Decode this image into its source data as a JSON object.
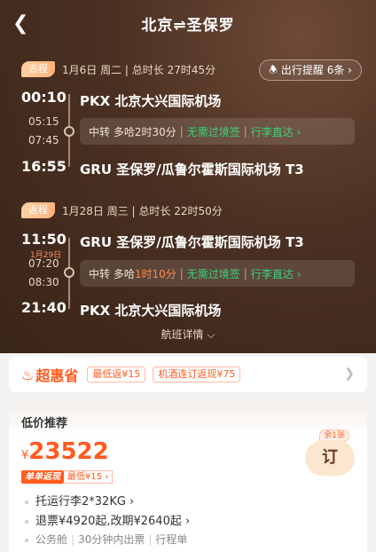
{
  "header": {
    "title": "北京⇌圣保罗",
    "back_icon": "chevron-left-icon"
  },
  "reminder": {
    "label": "出行提醒 6条 ›",
    "icon": "bell-icon"
  },
  "outbound": {
    "tag": "去程",
    "summary": "1月6日 周二 | 总时长 27时45分",
    "dep_time": "00:10",
    "dep_airport": "PKX 北京大兴国际机场",
    "transfer_arrive": "05:15",
    "transfer_depart": "07:45",
    "transfer_label": "中转 多哈",
    "transfer_duration": "2时30分",
    "visa": "无需过境签",
    "baggage": "行李直达 ›",
    "arr_time": "16:55",
    "arr_airport": "GRU 圣保罗/瓜鲁尔霍斯国际机场 T3"
  },
  "return": {
    "tag": "返程",
    "summary": "1月28日 周三 | 总时长 22时50分",
    "dep_time": "11:50",
    "dep_airport": "GRU 圣保罗/瓜鲁尔霍斯国际机场 T3",
    "next_day": "1月29日",
    "transfer_arrive": "07:20",
    "transfer_depart": "08:30",
    "transfer_label": "中转 多哈",
    "transfer_duration": "1时10分",
    "visa": "无需过境签",
    "baggage": "行李直达 ›",
    "arr_time": "21:40",
    "arr_airport": "PKX 北京大兴国际机场"
  },
  "flight_detail": "航班详情 ⌵",
  "promo": {
    "brand": "超惠省",
    "chips": [
      "最低返¥15",
      "机酒连订返现¥75"
    ],
    "accent": "#ff5a1f"
  },
  "fare": {
    "title": "低价推荐",
    "currency": "¥",
    "price": "23522",
    "badge": "单单返现",
    "badge_min": "最低¥15 ›",
    "remain": "余1张",
    "book": "订",
    "baggage": "托运行李2*32KG ›",
    "refund": "退票¥4920起,改期¥2640起 ›",
    "cabin": "公务舱",
    "ticketing": "30分钟内出票",
    "itinerary": "行程单"
  }
}
